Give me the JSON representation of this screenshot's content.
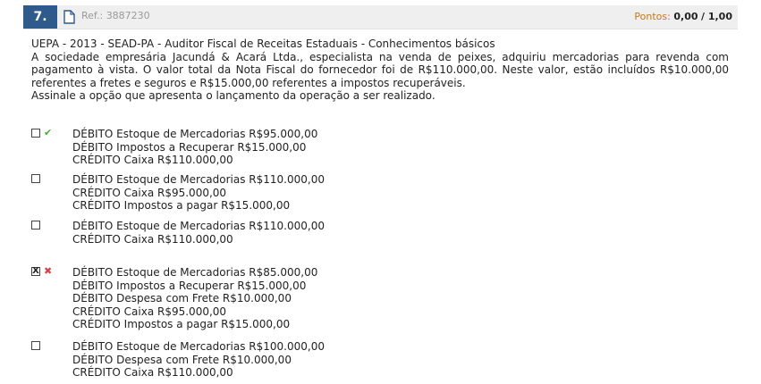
{
  "question": {
    "number": "7.",
    "ref": "Ref.: 3887230",
    "points_label": "Pontos:",
    "points_value": "0,00",
    "points_max": "/ 1,00"
  },
  "stem": {
    "source": "UEPA - 2013 - SEAD-PA - Auditor Fiscal de Receitas Estaduais - Conhecimentos básicos",
    "text": "A sociedade empresária Jacundá & Acará Ltda., especialista na venda de peixes, adquiriu mercadorias para revenda com pagamento à vista. O valor total da Nota Fiscal do fornecedor foi de R$110.000,00. Neste valor, estão incluídos R$10.000,00 referentes a fretes e seguros e R$15.000,00 referentes a impostos recuperáveis.",
    "prompt": "Assinale a opção que apresenta o lançamento da operação a ser realizado."
  },
  "options": [
    {
      "checked": false,
      "status": "correct",
      "status_icon": "✔",
      "lines": [
        "DÉBITO Estoque de Mercadorias R$95.000,00",
        "DÉBITO Impostos a Recuperar R$15.000,00",
        "CRÉDITO Caixa R$110.000,00"
      ]
    },
    {
      "checked": false,
      "status": "",
      "status_icon": "",
      "lines": [
        "DÉBITO Estoque de Mercadorias R$110.000,00",
        "CRÉDITO Caixa R$95.000,00",
        "CRÉDITO Impostos a pagar R$15.000,00"
      ]
    },
    {
      "checked": false,
      "status": "",
      "status_icon": "",
      "lines": [
        "DÉBITO Estoque de Mercadorias R$110.000,00",
        "CRÉDITO Caixa R$110.000,00"
      ]
    },
    {
      "checked": true,
      "check_glyph": "X",
      "status": "wrong",
      "status_icon": "✖",
      "lines": [
        "DÉBITO Estoque de Mercadorias R$85.000,00",
        "DÉBITO Impostos a Recuperar R$15.000,00",
        "DÉBITO Despesa com Frete R$10.000,00",
        "CRÉDITO Caixa R$95.000,00",
        "CRÉDITO Impostos a pagar R$15.000,00"
      ]
    },
    {
      "checked": false,
      "status": "",
      "status_icon": "",
      "lines": [
        "DÉBITO Estoque de Mercadorias R$100.000,00",
        "DÉBITO Despesa com Frete R$10.000,00",
        "CRÉDITO Caixa R$110.000,00"
      ]
    }
  ]
}
